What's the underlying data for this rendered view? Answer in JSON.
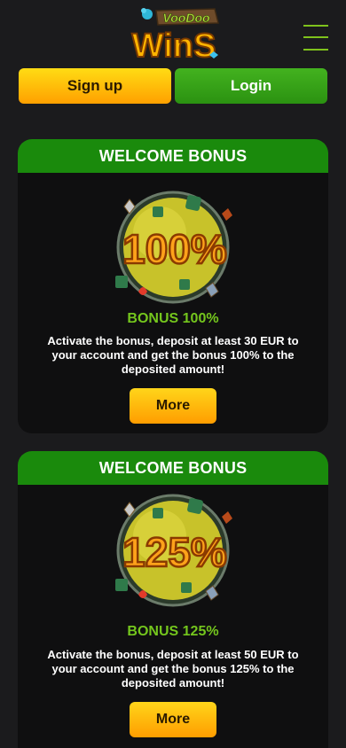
{
  "header": {
    "logo_top": "VooDoo",
    "logo_bottom": "WinS",
    "menu_icon": "hamburger-icon"
  },
  "auth": {
    "signup_label": "Sign up",
    "login_label": "Login"
  },
  "colors": {
    "background": "#1b1b1d",
    "card_bg": "#0f0f10",
    "card_header": "#1a8a0c",
    "accent_green": "#74c61d",
    "signup_yellow": "#ffb800",
    "login_green": "#3aa81a"
  },
  "bonuses": [
    {
      "header": "WELCOME BONUS",
      "badge": "100%",
      "title": "BONUS 100%",
      "description": "Activate the bonus, deposit at least 30 EUR to your account and get the bonus 100% to the deposited amount!",
      "button": "More"
    },
    {
      "header": "WELCOME BONUS",
      "badge": "125%",
      "title": "BONUS 125%",
      "description": "Activate the bonus, deposit at least 50 EUR to your account and get the bonus 125% to the deposited amount!",
      "button": "More"
    }
  ]
}
